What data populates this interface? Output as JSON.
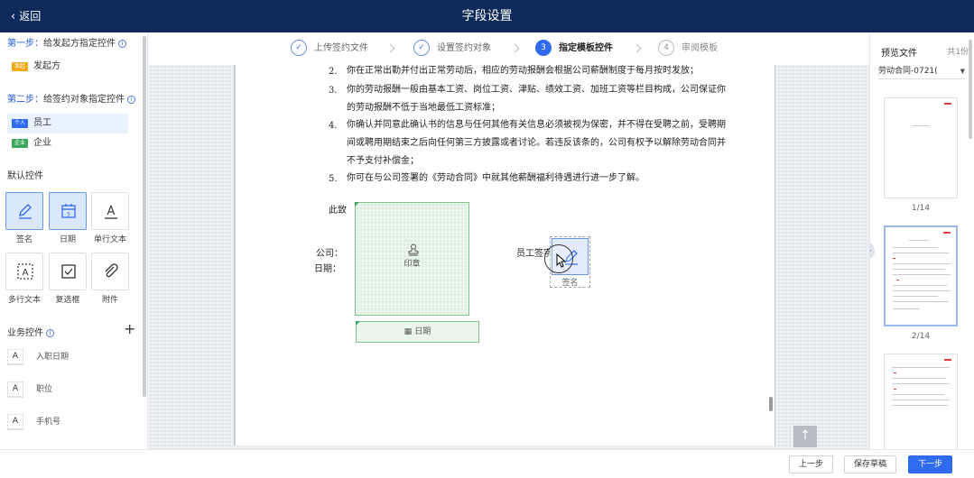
{
  "header": {
    "back_label": "返回",
    "title": "字段设置"
  },
  "left": {
    "step1_prefix": "第一步：",
    "step1_text": "给发起方指定控件",
    "initiator": {
      "tag": "发起",
      "name": "发起方"
    },
    "step2_prefix": "第二步：",
    "step2_text": "给签约对象指定控件",
    "signers": [
      {
        "tag": "个人",
        "name": "员工"
      },
      {
        "tag": "企业",
        "name": "企业"
      }
    ],
    "default_title": "默认控件",
    "controls": [
      "签名",
      "日期",
      "单行文本",
      "多行文本",
      "复选框",
      "附件"
    ],
    "business_title": "业务控件",
    "business_items": [
      "入职日期",
      "职位",
      "手机号"
    ]
  },
  "steps": [
    {
      "num": "1",
      "label": "上传签约文件",
      "state": "done"
    },
    {
      "num": "2",
      "label": "设置签约对象",
      "state": "done"
    },
    {
      "num": "3",
      "label": "指定模板控件",
      "state": "current"
    },
    {
      "num": "4",
      "label": "审阅模板",
      "state": "todo"
    }
  ],
  "document": {
    "items": [
      {
        "n": "2.",
        "lines": [
          "你在正常出勤并付出正常劳动后，相应的劳动报酬会根据公司薪酬制度于每月按时发放；"
        ]
      },
      {
        "n": "3.",
        "lines": [
          "你的劳动报酬一般由基本工资、岗位工资、津贴、绩效工资、加班工资等栏目构成，公司保证你",
          "的劳动报酬不低于当地最低工资标准；"
        ]
      },
      {
        "n": "4.",
        "lines": [
          "你确认并同意此确认书的信息与任何其他有关信息必须被视为保密，并不得在受聘之前，受聘期",
          "间或聘用期结束之后向任何第三方披露或者讨论。若违反该条的，公司有权予以解除劳动合同并",
          "不予支付补偿金；"
        ]
      },
      {
        "n": "5.",
        "lines": [
          "你可在与公司签署的《劳动合同》中就其他薪酬福利待遇进行进一步了解。"
        ]
      }
    ],
    "salutation": "此致",
    "company_label": "公司：",
    "date_label": "日期：",
    "employee_sign_label": "员工签字：",
    "seal_field": "印章",
    "date_field": "日期",
    "sign_field": "签名"
  },
  "preview": {
    "title": "预览文件",
    "count": "共1份",
    "file": "劳动合同-0721(",
    "pages": [
      "1/14",
      "2/14"
    ]
  },
  "footer": {
    "prev": "上一步",
    "save": "保存草稿",
    "next": "下一步"
  },
  "colors": {
    "header_bg": "#0e2a5a",
    "primary": "#2f6bf0",
    "seal_green": "#3aa85a"
  }
}
